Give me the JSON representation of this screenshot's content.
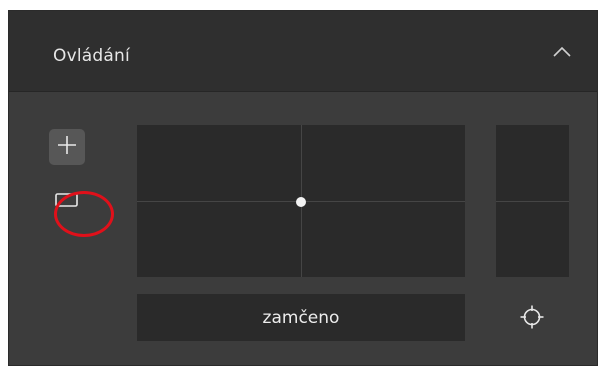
{
  "panel": {
    "title": "Ovládání",
    "collapse_icon": "chevron-up-icon"
  },
  "controls": {
    "zoom_in_icon": "plus-icon",
    "frame_icon": "rectangle-icon",
    "frame_highlight_color": "#e0101a",
    "recenter_icon": "crosshair-icon"
  },
  "lock_field": {
    "value": "zamčeno"
  },
  "colors": {
    "panel_bg": "#3c3c3c",
    "header_bg": "#2f2f2f",
    "pad_bg": "#2a2a2a",
    "text": "#e6e6e6"
  }
}
